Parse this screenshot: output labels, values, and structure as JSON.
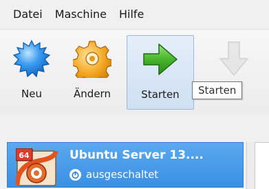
{
  "menu": {
    "items": [
      "Datei",
      "Maschine",
      "Hilfe"
    ]
  },
  "toolbar": {
    "buttons": [
      {
        "label": "Neu",
        "icon": "new-starburst-icon"
      },
      {
        "label": "Ändern",
        "icon": "settings-gear-icon"
      },
      {
        "label": "Starten",
        "icon": "start-arrow-icon"
      },
      {
        "label": "",
        "icon": "discard-arrow-down-icon"
      }
    ],
    "tooltip": "Starten"
  },
  "vm_list": {
    "items": [
      {
        "name": "Ubuntu Server 13....",
        "badge": "64",
        "status": "ausgeschaltet"
      }
    ]
  },
  "colors": {
    "selection": "#3b8fe3",
    "start_arrow": "#3fae2a",
    "gear": "#f0a020",
    "starburst": "#2b8fe6"
  }
}
